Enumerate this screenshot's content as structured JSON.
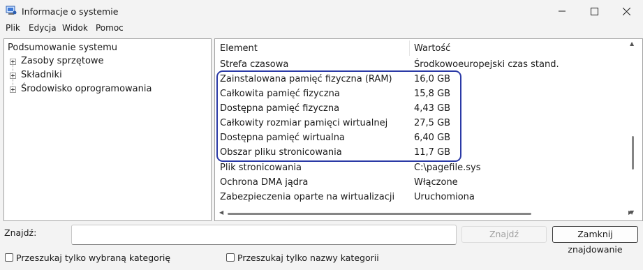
{
  "window": {
    "title": "Informacje o systemie"
  },
  "menu": [
    "Plik",
    "Edycja",
    "Widok",
    "Pomoc"
  ],
  "tree": {
    "root": "Podsumowanie systemu",
    "children": [
      "Zasoby sprzętowe",
      "Składniki",
      "Środowisko oprogramowania"
    ]
  },
  "list": {
    "headers": {
      "element": "Element",
      "value": "Wartość"
    },
    "rows": [
      {
        "element": "Strefa czasowa",
        "value": "Środkowoeuropejski czas stand."
      },
      {
        "element": "Zainstalowana pamięć fizyczna (RAM)",
        "value": "16,0 GB"
      },
      {
        "element": "Całkowita pamięć fizyczna",
        "value": "15,8 GB"
      },
      {
        "element": "Dostępna pamięć fizyczna",
        "value": "4,43 GB"
      },
      {
        "element": "Całkowity rozmiar pamięci wirtualnej",
        "value": "27,5 GB"
      },
      {
        "element": "Dostępna pamięć wirtualna",
        "value": "6,40 GB"
      },
      {
        "element": "Obszar pliku stronicowania",
        "value": "11,7 GB"
      },
      {
        "element": "Plik stronicowania",
        "value": "C:\\pagefile.sys"
      },
      {
        "element": "Ochrona DMA jądra",
        "value": "Włączone"
      },
      {
        "element": "Zabezpieczenia oparte na wirtualizacji",
        "value": "Uruchomiona"
      }
    ]
  },
  "search": {
    "label": "Znajdź:",
    "value": "",
    "find_button": "Znajdź",
    "close_button": "Zamknij znajdowanie",
    "option_selected_category": "Przeszukaj tylko wybraną kategorię",
    "option_category_names": "Przeszukaj tylko nazwy kategorii"
  },
  "colors": {
    "highlight": "#2b3aa6"
  }
}
